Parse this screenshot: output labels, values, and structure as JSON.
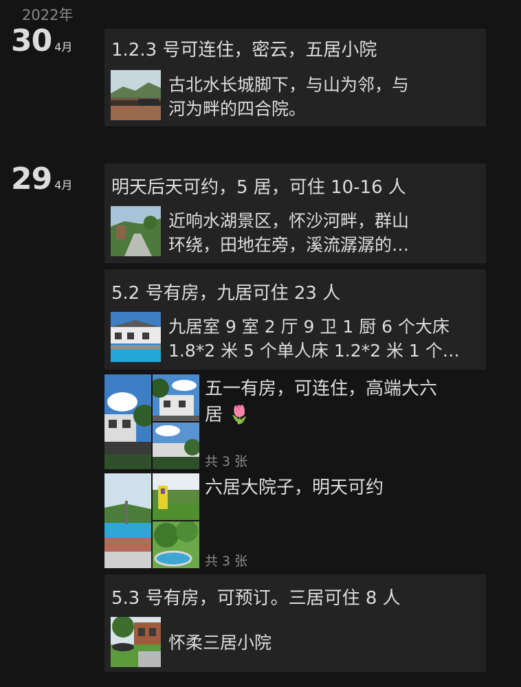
{
  "year": "2022年",
  "groups": [
    {
      "day": "30",
      "month": "4月",
      "posts": [
        {
          "title": "1.2.3 号可连住，密云，五居小院",
          "desc_line1": "古北水长城脚下，与山为邻，与",
          "desc_line2": "河为畔的四合院。"
        }
      ]
    },
    {
      "day": "29",
      "month": "4月",
      "posts": [
        {
          "title": "明天后天可约，5 居，可住 10-16 人",
          "desc_line1": "近响水湖景区，怀沙河畔，群山",
          "desc_line2": "环绕，田地在旁，溪流潺潺的…"
        },
        {
          "title": "5.2 号有房，九居可住 23 人",
          "desc_line1": "九居室 9 室 2 厅 9 卫 1 厨 6 个大床",
          "desc_line2": "1.8*2 米 5 个单人床 1.2*2 米 1 个…"
        },
        {
          "text_line1": "五一有房，可连住，高端大六",
          "text_line2": "居 🌷",
          "count": "共 3 张"
        },
        {
          "text_line1": "六居大院子，明天可约",
          "count": "共 3 张"
        },
        {
          "title": "5.3 号有房，可预订。三居可住 8 人",
          "desc_line1": "怀柔三居小院"
        }
      ]
    }
  ]
}
